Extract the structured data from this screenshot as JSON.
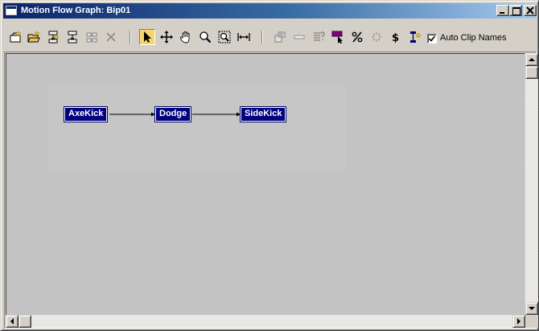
{
  "window": {
    "title": "Motion Flow Graph: Bip01"
  },
  "toolbar": {
    "icons": [
      "create-clip-icon",
      "create-multiple-clips-icon",
      "create-transition-icon",
      "create-transition-from-to-icon",
      "delete-transitions-icon",
      "delete-selection-icon",
      "select-arrow-icon",
      "move-icon",
      "pan-hand-icon",
      "zoom-icon",
      "zoom-region-icon",
      "zoom-extents-icon",
      "show-scripts-icon",
      "create-random-motion-icon",
      "clip-list-icon",
      "select-random-start-clip-icon",
      "percent-icon",
      "optimize-transitions-icon",
      "cost-icon",
      "select-clip-icon"
    ],
    "auto_clip_names_label": "Auto Clip Names",
    "auto_clip_names_checked": true,
    "active_tool": "select-arrow-icon"
  },
  "graph": {
    "nodes": [
      {
        "id": "n1",
        "label": "AxeKick"
      },
      {
        "id": "n2",
        "label": "Dodge"
      },
      {
        "id": "n3",
        "label": "SideKick"
      }
    ],
    "transitions": [
      {
        "from": "n1",
        "to": "n2"
      },
      {
        "from": "n2",
        "to": "n3"
      }
    ],
    "colors": {
      "node_fill": "#000080",
      "node_text": "#ffffff",
      "canvas": "#c3c3c3",
      "accent_magenta": "#800080",
      "active_tool_bg": "#f6d66c"
    }
  }
}
